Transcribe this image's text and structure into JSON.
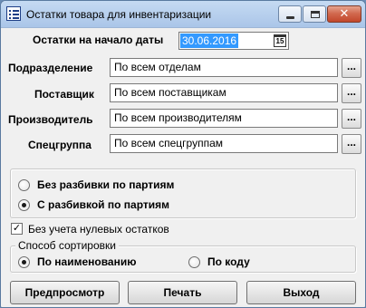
{
  "window": {
    "title": "Остатки товара для инвентаризации",
    "close_glyph": "✕"
  },
  "date": {
    "label": "Остатки на начало даты",
    "value": "30.06.2016",
    "calendar_glyph": "15"
  },
  "filters": [
    {
      "label": "Подразделение",
      "value": "По всем отделам",
      "button": "..."
    },
    {
      "label": "Поставщик",
      "value": "По всем поставщикам",
      "button": "..."
    },
    {
      "label": "Производитель",
      "value": "По всем производителям",
      "button": "..."
    },
    {
      "label": "Спецгруппа",
      "value": "По всем спецгруппам",
      "button": "..."
    }
  ],
  "batch_options": {
    "items": [
      "Без разбивки по партиям",
      "С разбивкой по партиям"
    ],
    "selected_index": 1
  },
  "zero_stock_checkbox": {
    "label": "Без учета нулевых остатков",
    "checked": true,
    "check_glyph": "✓"
  },
  "sorting": {
    "title": "Способ сортировки",
    "items": [
      "По наименованию",
      "По коду"
    ],
    "selected_index": 0
  },
  "buttons": {
    "preview": "Предпросмотр",
    "print": "Печать",
    "exit": "Выход"
  }
}
